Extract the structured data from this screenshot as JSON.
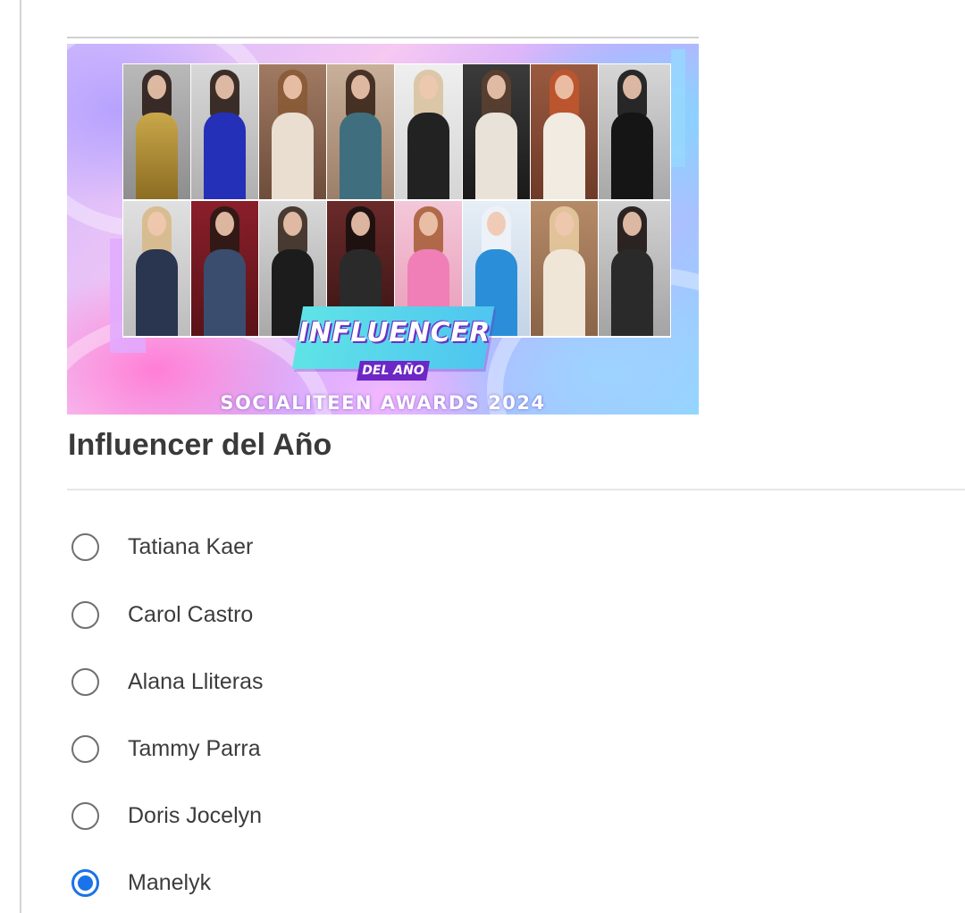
{
  "banner": {
    "award_title": "INFLUENCER",
    "award_subtitle": "DEL AÑO",
    "footer": "SOCIALITEEN AWARDS 2024"
  },
  "question": {
    "title": "Influencer del Año",
    "options": [
      {
        "label": "Tatiana Kaer",
        "selected": false
      },
      {
        "label": "Carol Castro",
        "selected": false
      },
      {
        "label": "Alana Lliteras",
        "selected": false
      },
      {
        "label": "Tammy Parra",
        "selected": false
      },
      {
        "label": "Doris Jocelyn",
        "selected": false
      },
      {
        "label": "Manelyk",
        "selected": true
      }
    ]
  },
  "colors": {
    "accent": "#1a73e8",
    "radio_border": "#6f6f6f",
    "title_text": "#3a3a3a"
  }
}
